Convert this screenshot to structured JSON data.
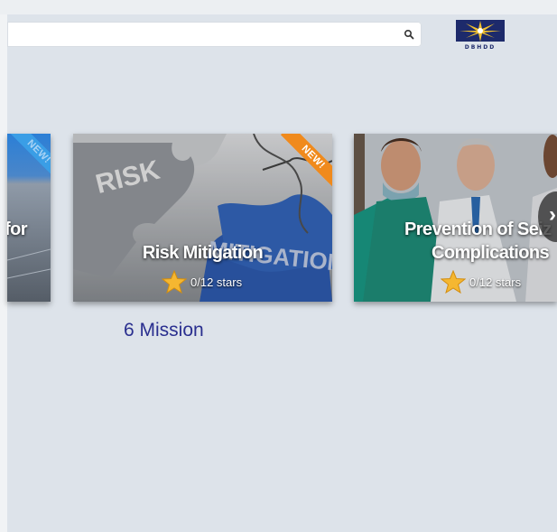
{
  "search": {
    "placeholder": "",
    "icon": "search-icon"
  },
  "logo": {
    "text": "DBHDD",
    "colors": {
      "navy": "#1d2a6b",
      "gold": "#f2c12e"
    }
  },
  "carousel": {
    "cards": [
      {
        "title": "t for",
        "badge": "NEW!"
      },
      {
        "title": "Risk Mitigation",
        "badge": "NEW!",
        "stars_text": "0/12 stars",
        "image_words": [
          "RISK",
          "MITIGATION"
        ]
      },
      {
        "title_line1": "Prevention of Seiz",
        "title_line2": "Complications",
        "stars_text": "0/12 stars"
      }
    ],
    "next_icon": "chevron-right-icon"
  },
  "missions_label": "6 Mission",
  "colors": {
    "background": "#dde3ea",
    "mission_text": "#2a2f8f",
    "badge_orange": "#f08a1c",
    "badge_blue": "#3a9ee6",
    "star": "#f5b731"
  }
}
